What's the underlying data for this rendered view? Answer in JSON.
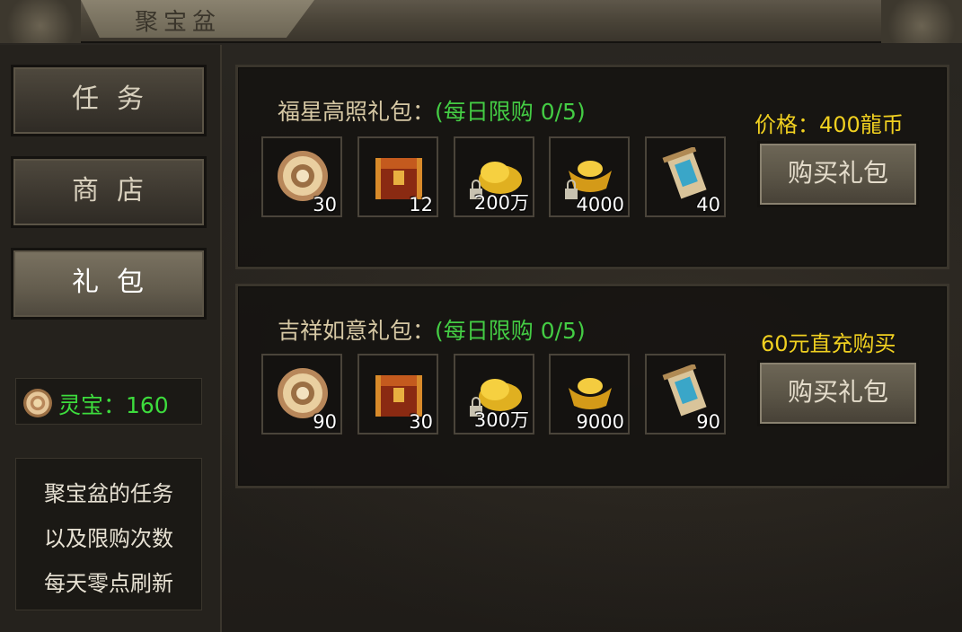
{
  "window": {
    "title": "聚宝盆"
  },
  "sidebar": {
    "items": [
      {
        "label": "任务",
        "active": false
      },
      {
        "label": "商店",
        "active": false
      },
      {
        "label": "礼包",
        "active": true
      }
    ],
    "currency": {
      "icon": "lingbao-coin-icon",
      "label": "灵宝：160"
    },
    "notice": [
      "聚宝盆的任务",
      "以及限购次数",
      "每天零点刷新"
    ]
  },
  "packs": [
    {
      "name": "福星高照礼包：",
      "limit": "(每日限购 0/5)",
      "price": "价格：400龍币",
      "buy_label": "购买礼包",
      "items": [
        {
          "icon": "medallion-icon",
          "count": "30"
        },
        {
          "icon": "treasure-chest-icon",
          "count": "12"
        },
        {
          "icon": "gold-coins-locked-icon",
          "count": "200万"
        },
        {
          "icon": "gold-ingot-locked-icon",
          "count": "4000"
        },
        {
          "icon": "scroll-icon",
          "count": "40"
        }
      ]
    },
    {
      "name": "吉祥如意礼包：",
      "limit": "(每日限购 0/5)",
      "price": "60元直充购买",
      "buy_label": "购买礼包",
      "items": [
        {
          "icon": "medallion-icon",
          "count": "90"
        },
        {
          "icon": "treasure-chest-icon",
          "count": "30"
        },
        {
          "icon": "gold-coins-locked-icon",
          "count": "300万"
        },
        {
          "icon": "gold-ingot-icon",
          "count": "9000"
        },
        {
          "icon": "scroll-icon",
          "count": "90"
        }
      ]
    }
  ],
  "colors": {
    "green": "#44cc44",
    "gold": "#f0d020",
    "title": "#d6c8a4"
  }
}
